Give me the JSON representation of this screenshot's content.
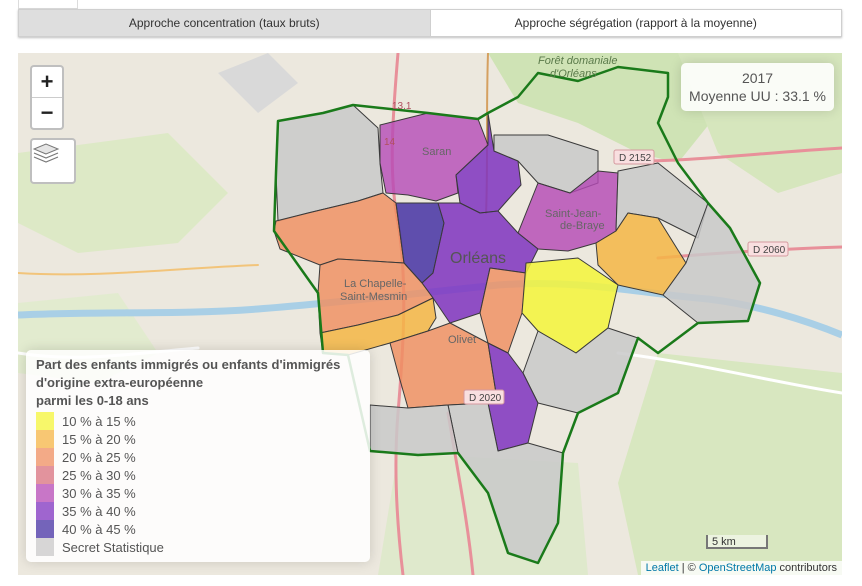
{
  "tabs": {
    "concentration_label": "Approche concentration (taux bruts)",
    "segregation_label": "Approche ségrégation (rapport à la moyenne)"
  },
  "zoom": {
    "in_label": "+",
    "out_label": "−"
  },
  "info": {
    "year": "2017",
    "average": "Moyenne UU : 33.1 %"
  },
  "legend": {
    "title_lines": [
      "Part des enfants immigrés ou enfants d'immigrés",
      "d'origine extra-européenne",
      "parmi les 0-18 ans"
    ],
    "classes": [
      {
        "label": "10 % à 15 %",
        "color": "#f4f53a"
      },
      {
        "label": "15 % à 20 %",
        "color": "#f5b645"
      },
      {
        "label": "20 % à 25 %",
        "color": "#ef8f60"
      },
      {
        "label": "25 % à 30 %",
        "color": "#d8707e"
      },
      {
        "label": "30 % à 35 %",
        "color": "#b54ab6"
      },
      {
        "label": "35 % à 40 %",
        "color": "#7f33c0"
      },
      {
        "label": "40 % à 45 %",
        "color": "#4632a4"
      },
      {
        "label": "Secret Statistique",
        "color": "#c9c9c9"
      }
    ]
  },
  "place_labels": {
    "foret": [
      "Forêt domaniale",
      "d'Orléans"
    ],
    "saran": "Saran",
    "saint_jean": [
      "Saint-Jean-",
      "de-Braye"
    ],
    "orleans": "Orléans",
    "chapelle": [
      "La Chapelle-",
      "Saint-Mesmin"
    ],
    "olivet": "Olivet"
  },
  "road_labels": {
    "d2152": "D 2152",
    "d2060": "D 2060",
    "d2020": "D 2020",
    "r131": "13.1",
    "r14": "14"
  },
  "scale": {
    "label": "5 km"
  },
  "attribution": {
    "leaflet": "Leaflet",
    "sep": " | © ",
    "osm": "OpenStreetMap",
    "contrib": " contributors"
  },
  "colors": {
    "boundary": "#1a7a1a",
    "river": "#a9cfe6",
    "road": "#f0a0a8",
    "green": "#cfe3b5"
  }
}
